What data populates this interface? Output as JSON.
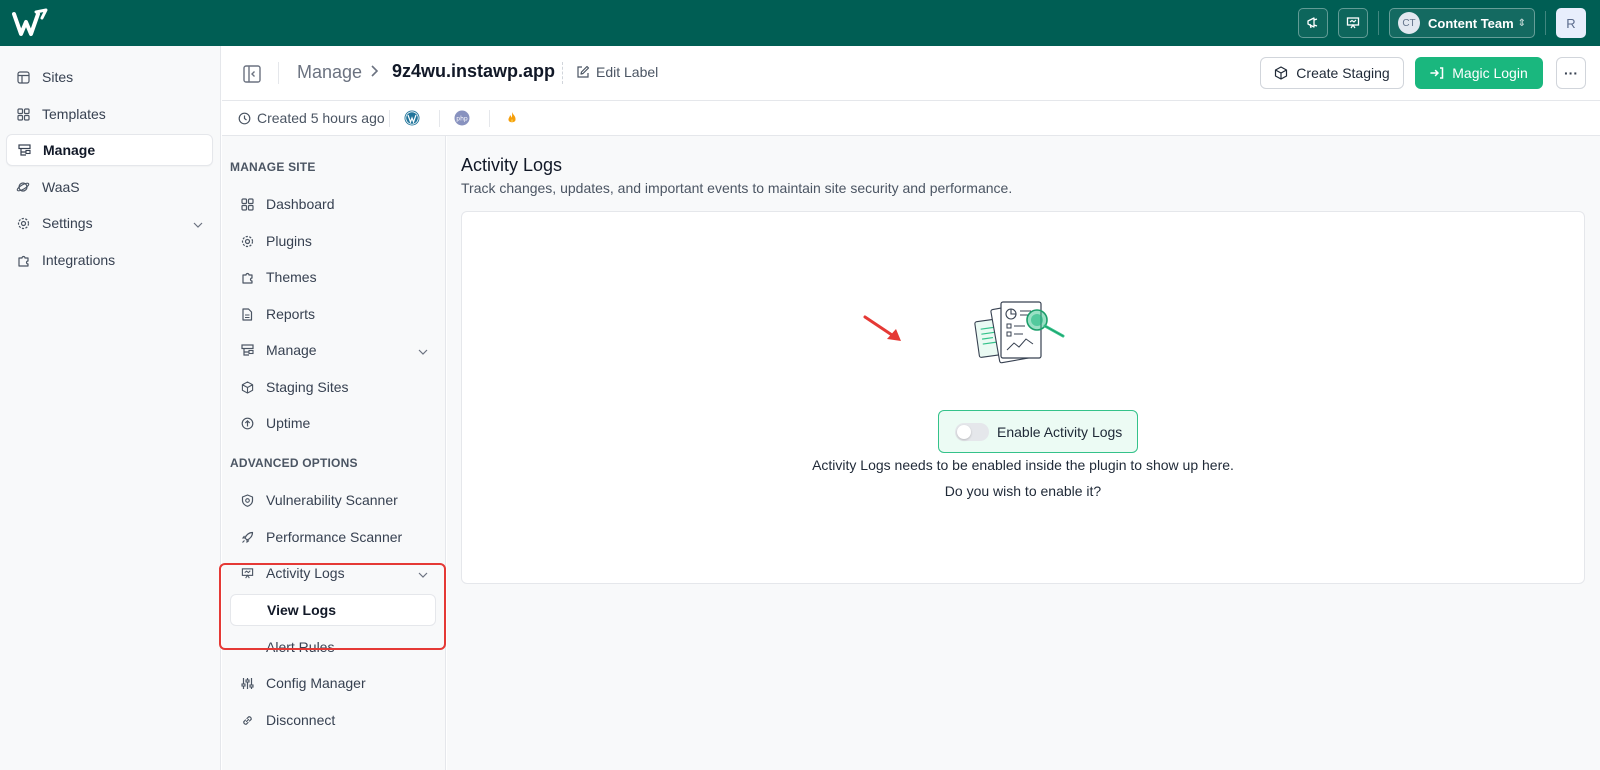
{
  "topbar": {
    "team_initials": "CT",
    "team_name": "Content Team",
    "user_initial": "R",
    "icons": [
      "megaphone-icon",
      "presentation-icon",
      "chevron-updown-icon"
    ]
  },
  "sidebar": {
    "items": [
      {
        "label": "Sites",
        "icon": "layout-icon"
      },
      {
        "label": "Templates",
        "icon": "grid-icon"
      },
      {
        "label": "Manage",
        "icon": "sitemap-icon",
        "active": true
      },
      {
        "label": "WaaS",
        "icon": "planet-icon"
      },
      {
        "label": "Settings",
        "icon": "gear-icon"
      },
      {
        "label": "Integrations",
        "icon": "puzzle-icon"
      }
    ]
  },
  "header": {
    "breadcrumb_root": "Manage",
    "site_name": "9z4wu.instawp.app",
    "edit_label": "Edit Label",
    "create_staging": "Create Staging",
    "magic_login": "Magic Login",
    "more": "···"
  },
  "meta": {
    "created": "Created 5 hours ago"
  },
  "subnav": {
    "heading_manage": "MANAGE SITE",
    "heading_advanced": "ADVANCED OPTIONS",
    "items": [
      {
        "label": "Dashboard",
        "icon": "grid-icon"
      },
      {
        "label": "Plugins",
        "icon": "gear-icon"
      },
      {
        "label": "Themes",
        "icon": "puzzle-icon"
      },
      {
        "label": "Reports",
        "icon": "file-icon"
      },
      {
        "label": "Manage",
        "icon": "sitemap-icon"
      },
      {
        "label": "Staging Sites",
        "icon": "box-icon"
      },
      {
        "label": "Uptime",
        "icon": "arrow-up-circle-icon"
      }
    ],
    "advanced_items": [
      {
        "label": "Vulnerability Scanner",
        "icon": "shield-icon"
      },
      {
        "label": "Performance Scanner",
        "icon": "rocket-icon"
      },
      {
        "label": "Activity Logs",
        "icon": "presentation-icon"
      },
      {
        "label": "View Logs"
      },
      {
        "label": "Alert Rules"
      },
      {
        "label": "Config Manager",
        "icon": "sliders-icon"
      },
      {
        "label": "Disconnect",
        "icon": "link-icon"
      }
    ]
  },
  "main": {
    "title": "Activity Logs",
    "subtitle": "Track changes, updates, and important events to maintain site security and performance.",
    "enable_label": "Enable Activity Logs",
    "message1": "Activity Logs needs to be enabled inside the plugin to show up here.",
    "message2": "Do you wish to enable it?"
  },
  "colors": {
    "topbar": "#005e54",
    "accent": "#1ab77e",
    "highlight": "#e53935"
  }
}
